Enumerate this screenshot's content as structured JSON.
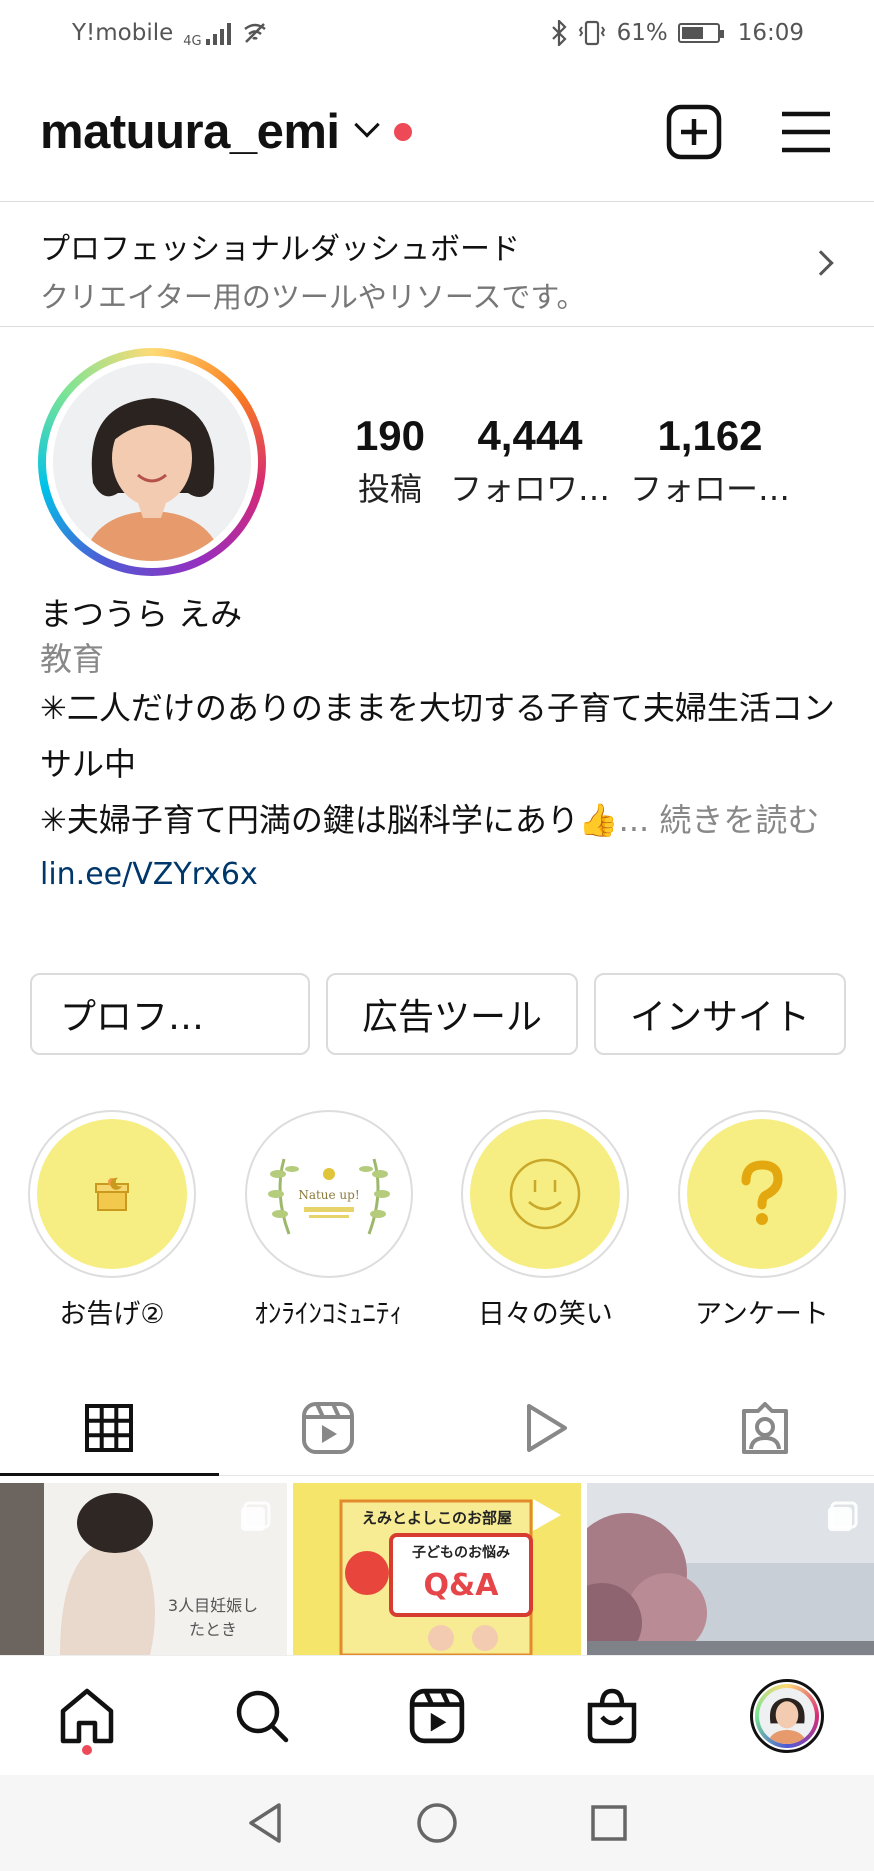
{
  "status_bar": {
    "carrier": "Y!mobile",
    "network": "4G",
    "battery": "61%",
    "battery_level": 0.61,
    "time": "16:09"
  },
  "header": {
    "username": "matuura_emi"
  },
  "dashboard": {
    "title": "プロフェッショナルダッシュボード",
    "subtitle": "クリエイター用のツールやリソースです。"
  },
  "stats": [
    {
      "value": "190",
      "label": "投稿"
    },
    {
      "value": "4,444",
      "label": "フォロワ…"
    },
    {
      "value": "1,162",
      "label": "フォロー…"
    }
  ],
  "bio": {
    "name": "まつうら えみ",
    "category": "教育",
    "line1": "✳︎二人だけのありのままを大切する子育て夫婦生活コンサル中",
    "line2": "✳︎夫婦子育て円満の鍵は脳科学にあり👍",
    "more": "... 続きを読む",
    "link": "lin.ee/VZYrx6x"
  },
  "buttons": {
    "profile": "プロフ…",
    "ads": "広告ツール",
    "insights": "インサイト"
  },
  "highlights": [
    {
      "label": "お告げ②",
      "icon": "gift-icon"
    },
    {
      "label": "ｵﾝﾗｲﾝｺﾐｭﾆﾃｨ",
      "icon": "natue-logo",
      "art_text": "Natue up!"
    },
    {
      "label": "日々の笑い",
      "icon": "smile-icon"
    },
    {
      "label": "アンケート",
      "icon": "question-icon"
    }
  ],
  "posts": [
    {
      "caption_line1": "3人目妊娠し",
      "caption_line2": "たとき"
    },
    {
      "header": "えみとよしこのお部屋",
      "title": "子どものお悩み",
      "qa": "Q&A"
    },
    {
      "caption": ""
    }
  ],
  "colors": {
    "accent_red": "#ed4956",
    "link": "#00376b",
    "highlight_yellow": "#f6ee82"
  }
}
